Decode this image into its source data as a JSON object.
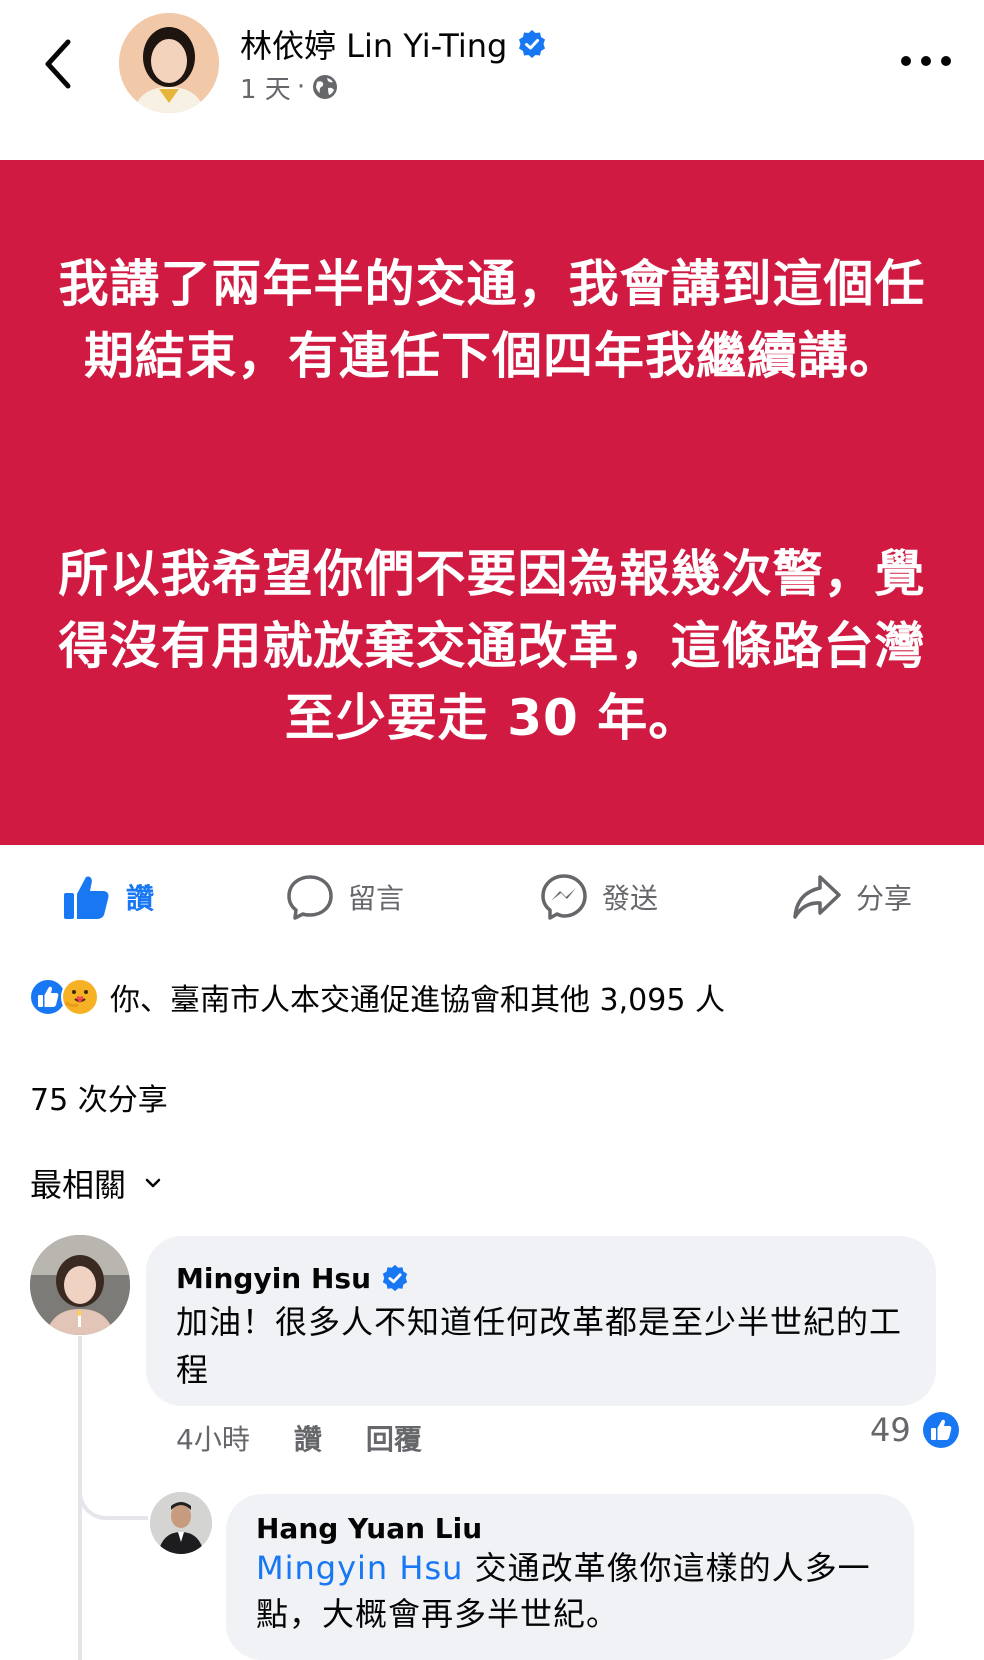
{
  "post": {
    "author": "林依婷 Lin Yi-Ting",
    "time": "1 天",
    "separator": "·",
    "privacy_icon": "globe-icon",
    "verified_icon": "verified-badge-icon",
    "banner_color": "#d11a42",
    "banner_paragraph_1": "我講了兩年半的交通，我會講到這個任期結束，有連任下個四年我繼續講。",
    "banner_paragraph_2": "所以我希望你們不要因為報幾次警，覺得沒有用就放棄交通改革，這條路台灣至少要走 30 年。"
  },
  "actions": {
    "like": "讚",
    "comment": "留言",
    "send": "發送",
    "share": "分享"
  },
  "reactions": {
    "icons": [
      "like-icon",
      "care-icon"
    ],
    "text": "你、臺南市人本交通促進協會和其他 3,095 人"
  },
  "shares_text": "75 次分享",
  "sort_label": "最相關",
  "comments": [
    {
      "author": "Mingyin Hsu",
      "verified": true,
      "text": "加油！很多人不知道任何改革都是至少半世紀的工程",
      "time": "4小時",
      "like_label": "讚",
      "reply_label": "回覆",
      "likes": "49",
      "replies": [
        {
          "author": "Hang Yuan Liu",
          "mention": "Mingyin Hsu",
          "text": " 交通改革像你這樣的人多一點，大概會再多半世紀。"
        }
      ]
    }
  ],
  "colors": {
    "accent": "#1877f2",
    "secondary_text": "#65676b",
    "bubble": "#f0f2f5"
  }
}
